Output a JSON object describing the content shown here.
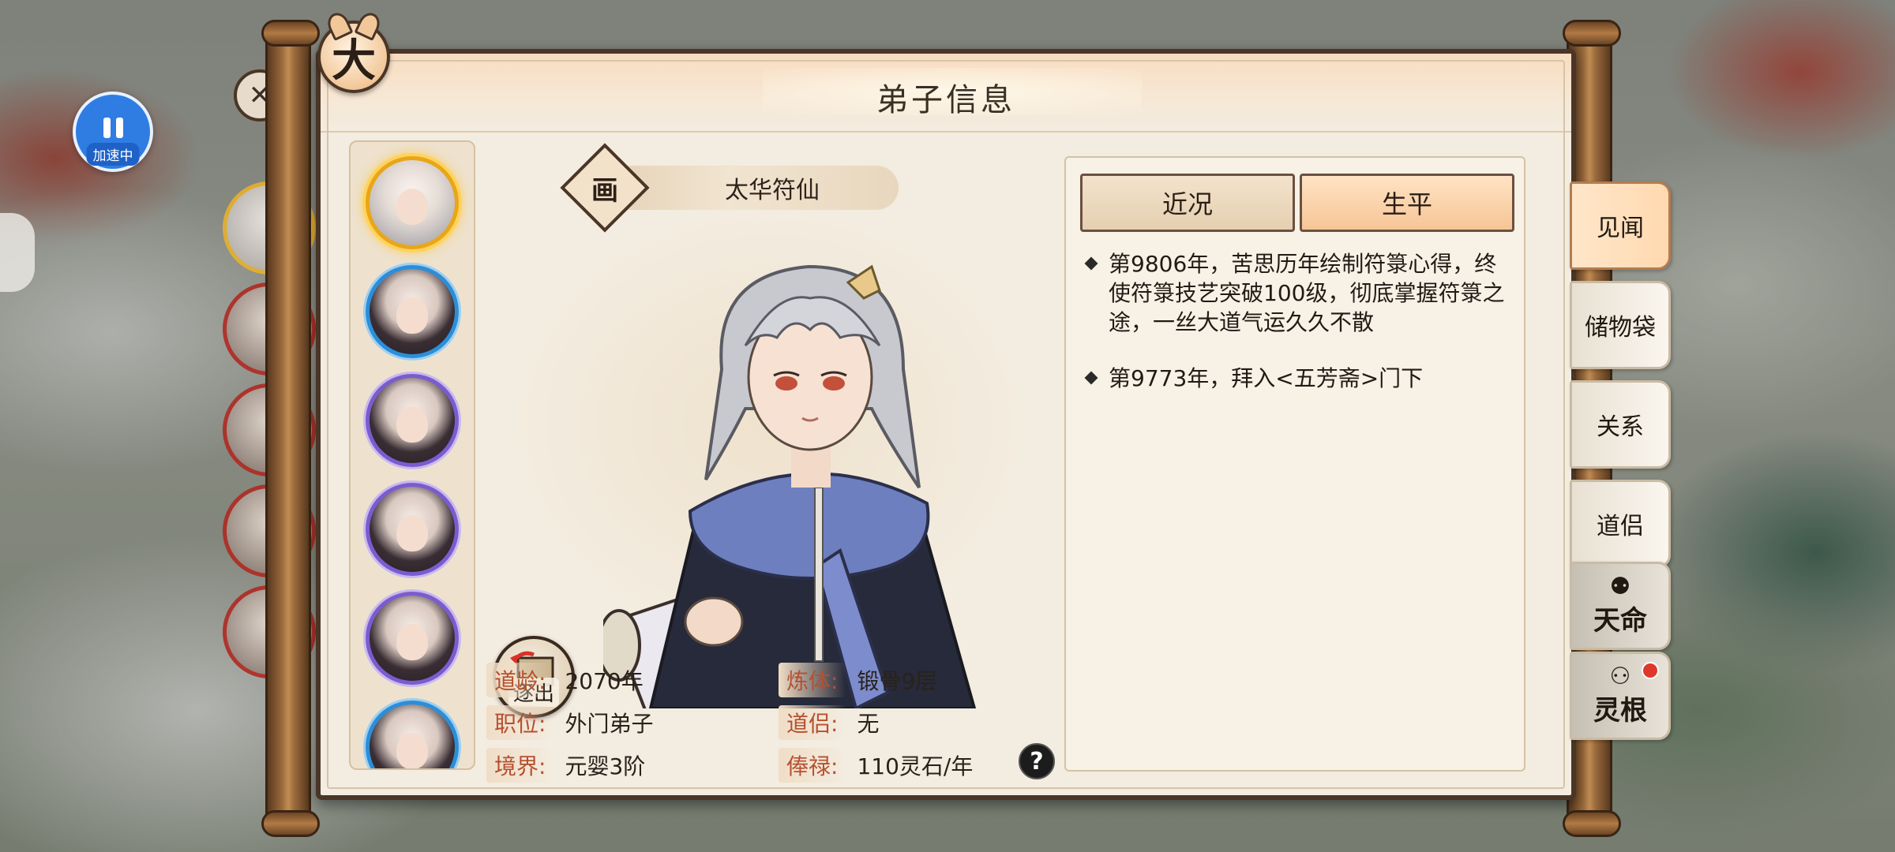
{
  "speed_widget": {
    "label": "加速中",
    "icon": "pause-icon"
  },
  "panel": {
    "title": "弟子信息",
    "close_icon": "close-icon",
    "close_glyph": "大"
  },
  "character": {
    "badge": "画",
    "name": "太华符仙",
    "expel_label": "逐出"
  },
  "stats": {
    "age_label": "道龄:",
    "age_value": "2070年",
    "body_label": "炼体:",
    "body_value": "锻骨9层",
    "position_label": "职位:",
    "position_value": "外门弟子",
    "partner_label": "道侣:",
    "partner_value": "无",
    "realm_label": "境界:",
    "realm_value": "元婴3阶",
    "salary_label": "俸禄:",
    "salary_value": "110灵石/年",
    "help": "?"
  },
  "info_tabs": [
    {
      "label": "近况",
      "active": false
    },
    {
      "label": "生平",
      "active": true
    }
  ],
  "events": [
    "第9806年，苦思历年绘制符箓心得，终使符箓技艺突破100级，彻底掌握符箓之途，一丝大道气运久久不散",
    "第9773年，拜入<五芳斋>门下"
  ],
  "side_tabs": [
    {
      "label": "见闻",
      "active": true
    },
    {
      "label": "储物袋"
    },
    {
      "label": "关系"
    },
    {
      "label": "道侣"
    },
    {
      "label": "天命"
    },
    {
      "label": "灵根"
    }
  ],
  "colors": {
    "accent": "#f6c596",
    "label_red": "#b5502f",
    "frame_brown": "#4a3526",
    "selected_gold": "#e9a617",
    "avatar_purple": "#7b5ccf",
    "avatar_blue": "#2c8ed8"
  }
}
